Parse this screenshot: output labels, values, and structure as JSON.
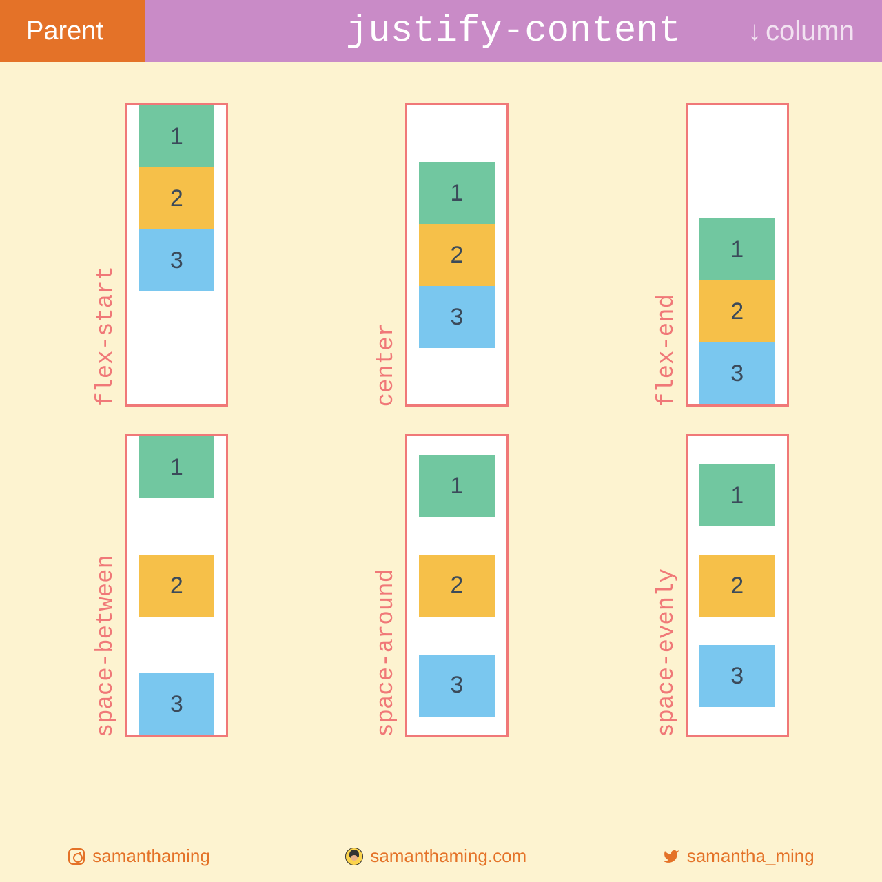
{
  "header": {
    "parent": "Parent",
    "title": "justify-content",
    "direction_arrow": "↓",
    "direction": "column"
  },
  "items": [
    "1",
    "2",
    "3"
  ],
  "demos": [
    {
      "label": "flex-start",
      "justify": "flex-start"
    },
    {
      "label": "center",
      "justify": "center"
    },
    {
      "label": "flex-end",
      "justify": "flex-end"
    },
    {
      "label": "space-between",
      "justify": "space-between"
    },
    {
      "label": "space-around",
      "justify": "space-around"
    },
    {
      "label": "space-evenly",
      "justify": "space-evenly"
    }
  ],
  "footer": {
    "instagram": "samanthaming",
    "website": "samanthaming.com",
    "twitter": "samantha_ming"
  },
  "colors": {
    "orange": "#e47228",
    "purple": "#c98bc7",
    "cream": "#fdf3d0",
    "coral": "#f07878",
    "green": "#71c7a0",
    "yellow": "#f6c049",
    "blue": "#7ac7ef"
  }
}
